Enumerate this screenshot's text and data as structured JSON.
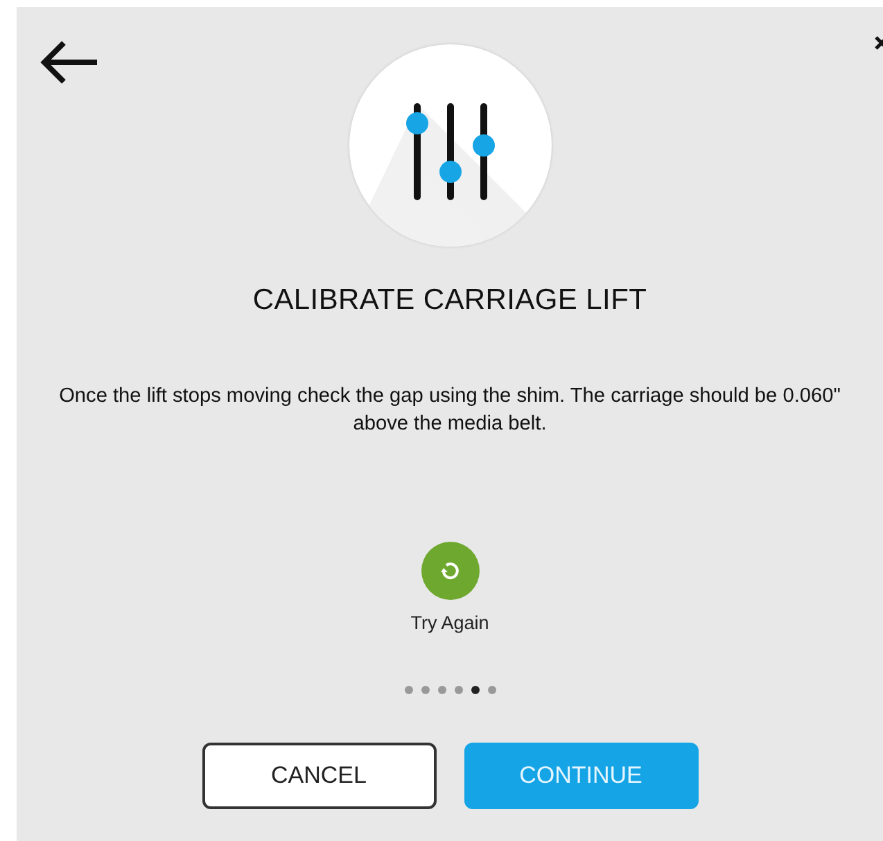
{
  "title": "CALIBRATE CARRIAGE LIFT",
  "instruction": "Once the lift stops moving check the gap using the shim. The carriage should be 0.060\" above the media belt.",
  "retry": {
    "label": "Try Again"
  },
  "steps": [
    {
      "selected": false
    },
    {
      "selected": false
    },
    {
      "selected": false
    },
    {
      "selected": false
    },
    {
      "selected": true
    },
    {
      "selected": false
    }
  ],
  "buttons": [
    {
      "label": "CANCEL",
      "kind": "secondary"
    },
    {
      "label": "CONTINUE",
      "kind": "primary"
    }
  ]
}
